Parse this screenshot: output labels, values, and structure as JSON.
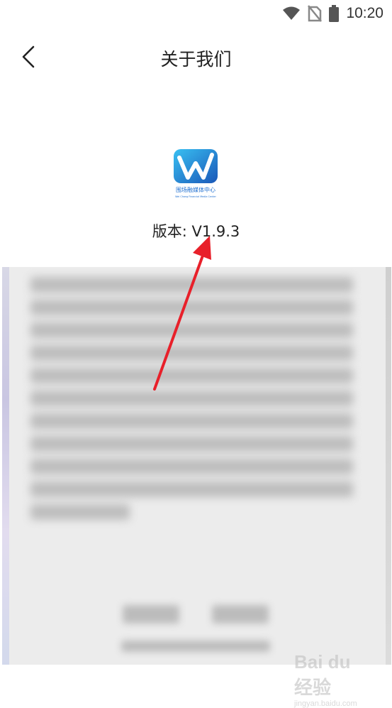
{
  "status_bar": {
    "time": "10:20",
    "icons": [
      "wifi-icon",
      "no-sim-icon",
      "battery-icon"
    ]
  },
  "header": {
    "title": "关于我们",
    "back_icon": "chevron-left-icon"
  },
  "app": {
    "logo_caption": "围场融媒体中心",
    "logo_subcaption": "Wei Chang Financial Media Center",
    "version_text": "版本: V1.9.3"
  },
  "watermark": {
    "main": "Bai du 经验",
    "sub": "jingyan.baidu.com"
  },
  "colors": {
    "arrow": "#e8202a",
    "logo_blue": "#1f6fd0",
    "logo_cyan": "#34b7f0"
  }
}
